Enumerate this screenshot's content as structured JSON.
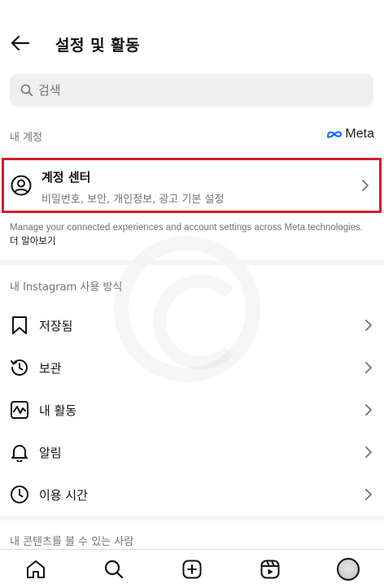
{
  "header": {
    "title": "설정 및 활동",
    "back_icon": "arrow-left-icon"
  },
  "search": {
    "placeholder": "검색",
    "value": ""
  },
  "my_account": {
    "section_label": "내 계정",
    "brand": "Meta",
    "accounts_center": {
      "title": "계정 센터",
      "subtitle": "비밀번호, 보안, 개인정보, 광고 기본 설정",
      "highlight_color": "#d11f28"
    },
    "manage_text": "Manage your connected experiences and account settings across Meta technologies.",
    "learn_more": "더 알아보기"
  },
  "how_you_use": {
    "section_label": "내 Instagram 사용 방식",
    "items": [
      {
        "label": "저장됨",
        "icon": "bookmark-icon"
      },
      {
        "label": "보관",
        "icon": "archive-clock-icon"
      },
      {
        "label": "내 활동",
        "icon": "activity-icon"
      },
      {
        "label": "알림",
        "icon": "bell-icon"
      },
      {
        "label": "이용 시간",
        "icon": "clock-icon"
      }
    ]
  },
  "who_can_see": {
    "section_label": "내 콘텐츠를 볼 수 있는 사람"
  },
  "bottom_nav": [
    "home-icon",
    "search-icon",
    "create-icon",
    "reels-icon",
    "profile-avatar"
  ]
}
